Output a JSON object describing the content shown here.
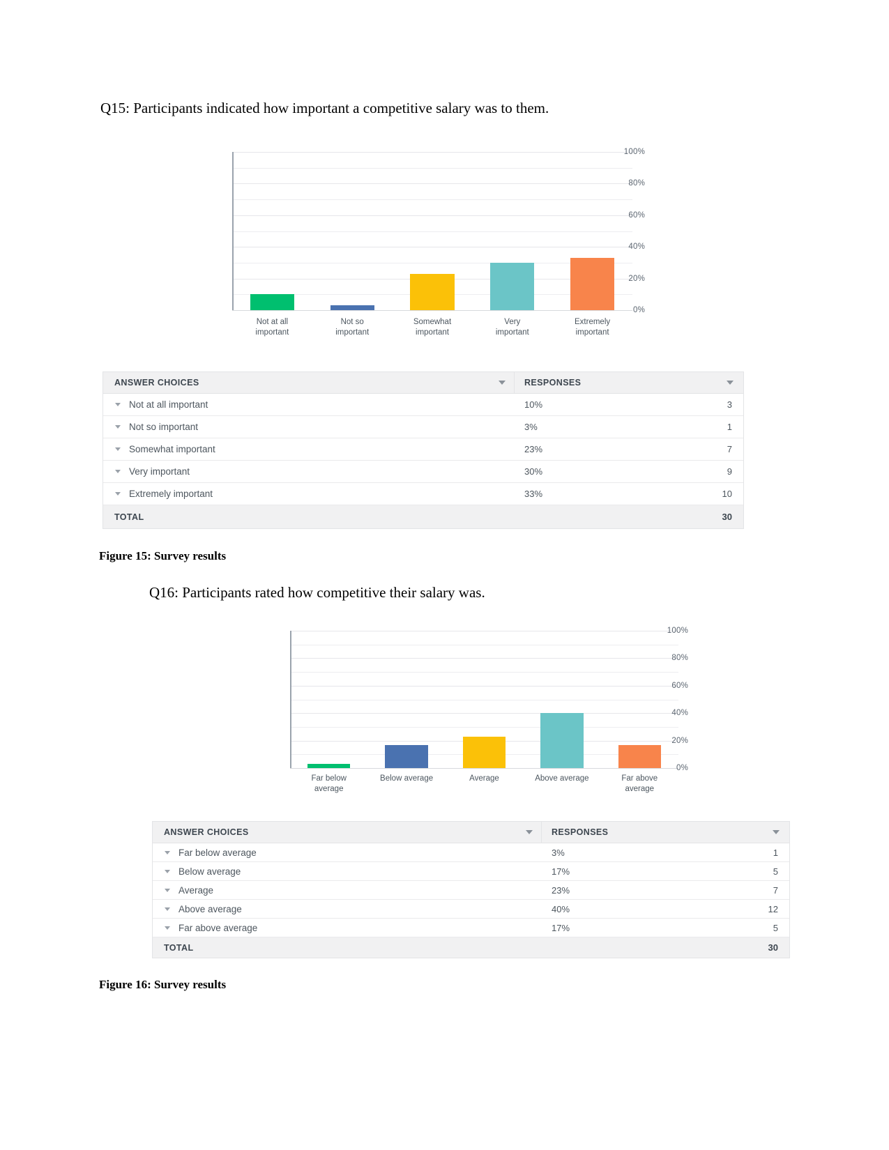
{
  "document": {
    "q15_heading": "Q15: Participants indicated how important a competitive salary was to them.",
    "q16_heading": "Q16: Participants rated how competitive their salary was.",
    "figure15_caption": "Figure 15: Survey results",
    "figure16_caption": "Figure 16: Survey results"
  },
  "table_headers": {
    "answer_choices": "ANSWER CHOICES",
    "responses": "RESPONSES",
    "total": "TOTAL"
  },
  "q15": {
    "rows": [
      {
        "label": "Not at all important",
        "percent": "10%",
        "count": "3"
      },
      {
        "label": "Not so important",
        "percent": "3%",
        "count": "1"
      },
      {
        "label": "Somewhat important",
        "percent": "23%",
        "count": "7"
      },
      {
        "label": "Very important",
        "percent": "30%",
        "count": "9"
      },
      {
        "label": "Extremely important",
        "percent": "33%",
        "count": "10"
      }
    ],
    "total_count": "30"
  },
  "q16": {
    "rows": [
      {
        "label": "Far below average",
        "percent": "3%",
        "count": "1"
      },
      {
        "label": "Below average",
        "percent": "17%",
        "count": "5"
      },
      {
        "label": "Average",
        "percent": "23%",
        "count": "7"
      },
      {
        "label": "Above average",
        "percent": "40%",
        "count": "12"
      },
      {
        "label": "Far above average",
        "percent": "17%",
        "count": "5"
      }
    ],
    "total_count": "30"
  },
  "chart_data": [
    {
      "type": "bar",
      "title": "",
      "xlabel": "",
      "ylabel": "",
      "categories": [
        "Not at all\nimportant",
        "Not so\nimportant",
        "Somewhat\nimportant",
        "Very\nimportant",
        "Extremely\nimportant"
      ],
      "values": [
        10,
        3,
        23,
        30,
        33
      ],
      "colors": [
        "#00bf6f",
        "#4a72b0",
        "#fbc108",
        "#6bc5c7",
        "#f8844b"
      ],
      "ylim": [
        0,
        100
      ],
      "yticks": [
        0,
        20,
        40,
        60,
        80,
        100
      ],
      "ytick_labels": [
        "0%",
        "20%",
        "40%",
        "60%",
        "80%",
        "100%"
      ],
      "grid": true,
      "legend": "none"
    },
    {
      "type": "bar",
      "title": "",
      "xlabel": "",
      "ylabel": "",
      "categories": [
        "Far below\naverage",
        "Below average",
        "Average",
        "Above average",
        "Far above\naverage"
      ],
      "values": [
        3,
        17,
        23,
        40,
        17
      ],
      "colors": [
        "#00bf6f",
        "#4a72b0",
        "#fbc108",
        "#6bc5c7",
        "#f8844b"
      ],
      "ylim": [
        0,
        100
      ],
      "yticks": [
        0,
        20,
        40,
        60,
        80,
        100
      ],
      "ytick_labels": [
        "0%",
        "20%",
        "40%",
        "60%",
        "80%",
        "100%"
      ],
      "grid": true,
      "legend": "none"
    }
  ]
}
